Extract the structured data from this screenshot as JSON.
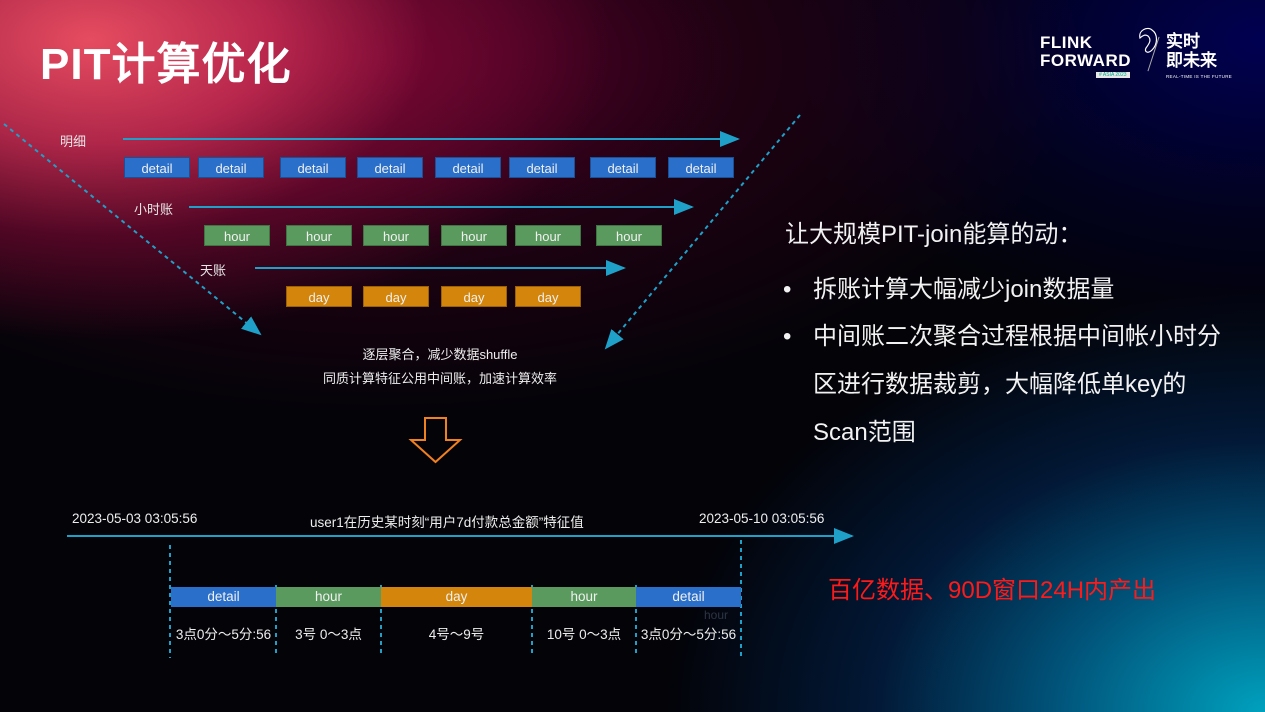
{
  "title": "PIT计算优化",
  "logo": {
    "line1": "FLINK",
    "line2": "FORWARD",
    "edition": "# ASIA 2023",
    "cn_line1": "实时",
    "cn_line2": "即未来",
    "tagline": "REAL-TIME IS THE FUTURE"
  },
  "diagram": {
    "levels": [
      {
        "label": "明细",
        "blocks": [
          "detail",
          "detail",
          "detail",
          "detail",
          "detail",
          "detail",
          "detail",
          "detail"
        ]
      },
      {
        "label": "小时账",
        "blocks": [
          "hour",
          "hour",
          "hour",
          "hour",
          "hour",
          "hour"
        ]
      },
      {
        "label": "天账",
        "blocks": [
          "day",
          "day",
          "day",
          "day"
        ]
      }
    ],
    "caption_line1": "逐层聚合，减少数据shuffle",
    "caption_line2": "同质计算特征公用中间账，加速计算效率",
    "accent_line_color": "#1fa0c8",
    "arrow_color": "#f08020"
  },
  "right_panel": {
    "heading": "让大规模PIT-join能算的动：",
    "bullets": [
      "拆账计算大幅减少join数据量",
      "中间账二次聚合过程根据中间帐小时分区进行数据裁剪，大幅降低单key的Scan范围"
    ],
    "bullet_lines": [
      [
        "拆账计算大幅减少join数据量"
      ],
      [
        "中间账二次聚合过程根据中间帐小时分",
        "区进行数据裁剪，大幅降低单key的",
        "Scan范围"
      ]
    ],
    "bullet_glyph": "•"
  },
  "timeline": {
    "start": "2023-05-03 03:05:56",
    "end": "2023-05-10 03:05:56",
    "title": "user1在历史某时刻“用户7d付款总金额”特征值",
    "segments": [
      {
        "type": "detail",
        "label": "detail",
        "range": "3点0分～5分:56"
      },
      {
        "type": "hour",
        "label": "hour",
        "range": "3号 0～3点"
      },
      {
        "type": "day",
        "label": "day",
        "range": "4号～9号"
      },
      {
        "type": "hour",
        "label": "hour",
        "range": "10号 0～3点"
      },
      {
        "type": "detail",
        "label": "detail",
        "range": "3点0分～5分:56"
      }
    ],
    "ghost_text": "hour",
    "colors": {
      "detail": "#2a6fca",
      "hour": "#5a9a5e",
      "day": "#d4850b"
    }
  },
  "highlight": "百亿数据、90D窗口24H内产出"
}
